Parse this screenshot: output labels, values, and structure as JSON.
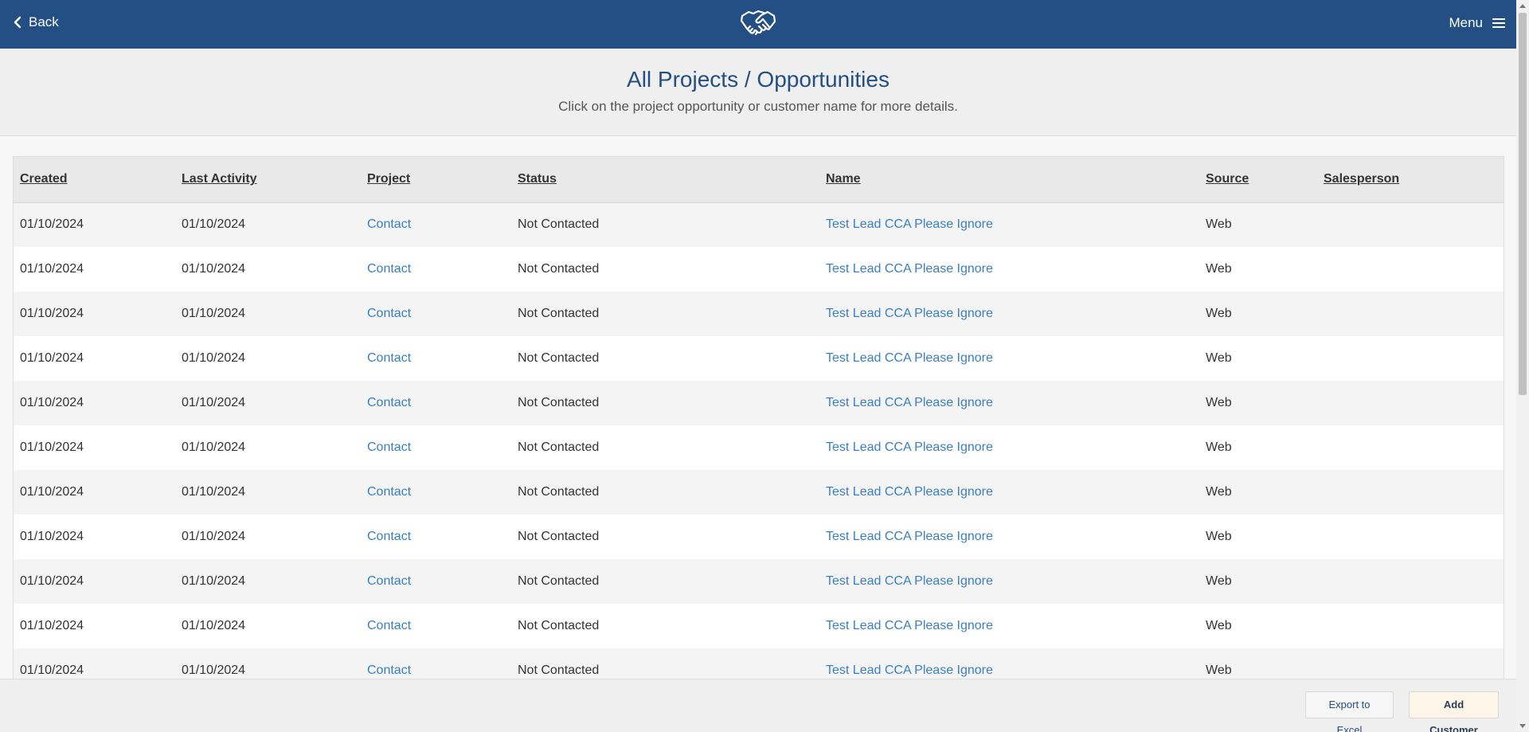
{
  "nav": {
    "back_label": "Back",
    "menu_label": "Menu",
    "logo_icon": "handshake-icon"
  },
  "header": {
    "title": "All Projects / Opportunities",
    "subtitle": "Click on the project opportunity or customer name for more details."
  },
  "table": {
    "columns": [
      "Created",
      "Last Activity",
      "Project",
      "Status",
      "Name",
      "Source",
      "Salesperson"
    ],
    "rows": [
      {
        "created": "01/10/2024",
        "last_activity": "01/10/2024",
        "project": "Contact",
        "status": "Not Contacted",
        "name": "Test Lead CCA Please Ignore",
        "source": "Web",
        "salesperson": ""
      },
      {
        "created": "01/10/2024",
        "last_activity": "01/10/2024",
        "project": "Contact",
        "status": "Not Contacted",
        "name": "Test Lead CCA Please Ignore",
        "source": "Web",
        "salesperson": ""
      },
      {
        "created": "01/10/2024",
        "last_activity": "01/10/2024",
        "project": "Contact",
        "status": "Not Contacted",
        "name": "Test Lead CCA Please Ignore",
        "source": "Web",
        "salesperson": ""
      },
      {
        "created": "01/10/2024",
        "last_activity": "01/10/2024",
        "project": "Contact",
        "status": "Not Contacted",
        "name": "Test Lead CCA Please Ignore",
        "source": "Web",
        "salesperson": ""
      },
      {
        "created": "01/10/2024",
        "last_activity": "01/10/2024",
        "project": "Contact",
        "status": "Not Contacted",
        "name": "Test Lead CCA Please Ignore",
        "source": "Web",
        "salesperson": ""
      },
      {
        "created": "01/10/2024",
        "last_activity": "01/10/2024",
        "project": "Contact",
        "status": "Not Contacted",
        "name": "Test Lead CCA Please Ignore",
        "source": "Web",
        "salesperson": ""
      },
      {
        "created": "01/10/2024",
        "last_activity": "01/10/2024",
        "project": "Contact",
        "status": "Not Contacted",
        "name": "Test Lead CCA Please Ignore",
        "source": "Web",
        "salesperson": ""
      },
      {
        "created": "01/10/2024",
        "last_activity": "01/10/2024",
        "project": "Contact",
        "status": "Not Contacted",
        "name": "Test Lead CCA Please Ignore",
        "source": "Web",
        "salesperson": ""
      },
      {
        "created": "01/10/2024",
        "last_activity": "01/10/2024",
        "project": "Contact",
        "status": "Not Contacted",
        "name": "Test Lead CCA Please Ignore",
        "source": "Web",
        "salesperson": ""
      },
      {
        "created": "01/10/2024",
        "last_activity": "01/10/2024",
        "project": "Contact",
        "status": "Not Contacted",
        "name": "Test Lead CCA Please Ignore",
        "source": "Web",
        "salesperson": ""
      },
      {
        "created": "01/10/2024",
        "last_activity": "01/10/2024",
        "project": "Contact",
        "status": "Not Contacted",
        "name": "Test Lead CCA Please Ignore",
        "source": "Web",
        "salesperson": ""
      }
    ]
  },
  "footer": {
    "export_label": "Export to Excel",
    "add_customer_label": "Add Customer"
  },
  "colors": {
    "navbar": "#234f84",
    "title": "#234f84",
    "link": "#3a7fc4"
  }
}
